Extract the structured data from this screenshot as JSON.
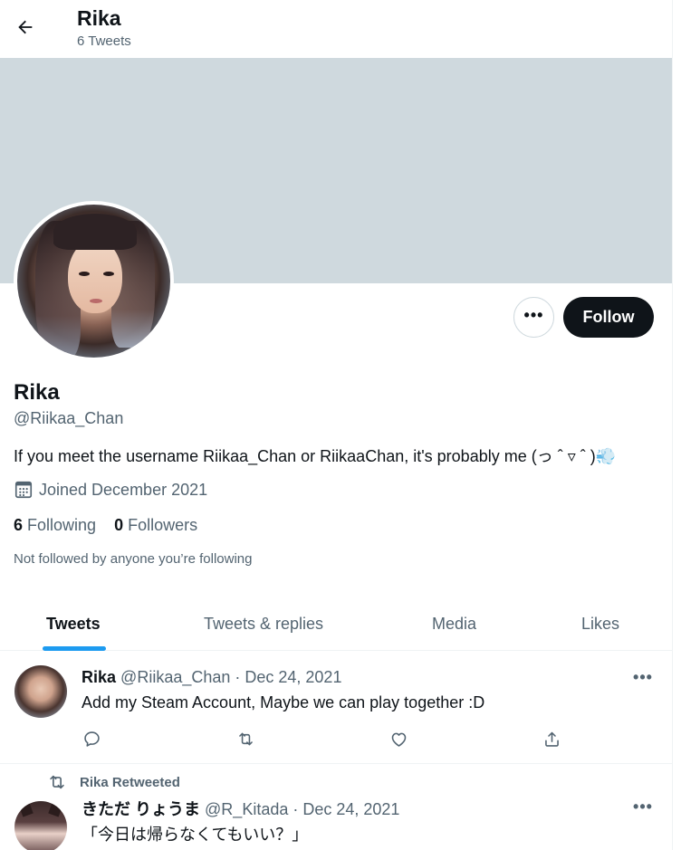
{
  "header": {
    "title": "Rika",
    "tweet_count": "6 Tweets"
  },
  "profile": {
    "name": "Rika",
    "handle": "@Riikaa_Chan",
    "bio": "If you meet the username Riikaa_Chan or RiikaaChan, it's probably me (っ ˆ ▿ ˆ )💨",
    "joined": "Joined December 2021",
    "following_count": "6",
    "following_label": "Following",
    "followers_count": "0",
    "followers_label": "Followers",
    "not_followed_text": "Not followed by anyone you’re following",
    "follow_button": "Follow",
    "more_button": "•••"
  },
  "tabs": [
    {
      "label": "Tweets",
      "active": true
    },
    {
      "label": "Tweets & replies",
      "active": false
    },
    {
      "label": "Media",
      "active": false
    },
    {
      "label": "Likes",
      "active": false
    }
  ],
  "tweets": [
    {
      "name": "Rika",
      "handle_date": "@Riikaa_Chan · Dec 24, 2021",
      "text": "Add my Steam Account, Maybe we can play together :D",
      "more": "•••"
    },
    {
      "retweet_label": "Rika Retweeted",
      "name": "きただ りょうま",
      "handle_date": "@R_Kitada · Dec 24, 2021",
      "text": "「今日は帰らなくてもいい？」",
      "more": "•••"
    }
  ],
  "colors": {
    "accent": "#1d9bf0",
    "banner": "#cfd9de",
    "follow_button_bg": "#0f1419",
    "secondary_text": "#536471"
  },
  "icons": [
    "back-arrow-icon",
    "calendar-icon",
    "reply-icon",
    "retweet-icon",
    "like-icon",
    "share-icon"
  ]
}
